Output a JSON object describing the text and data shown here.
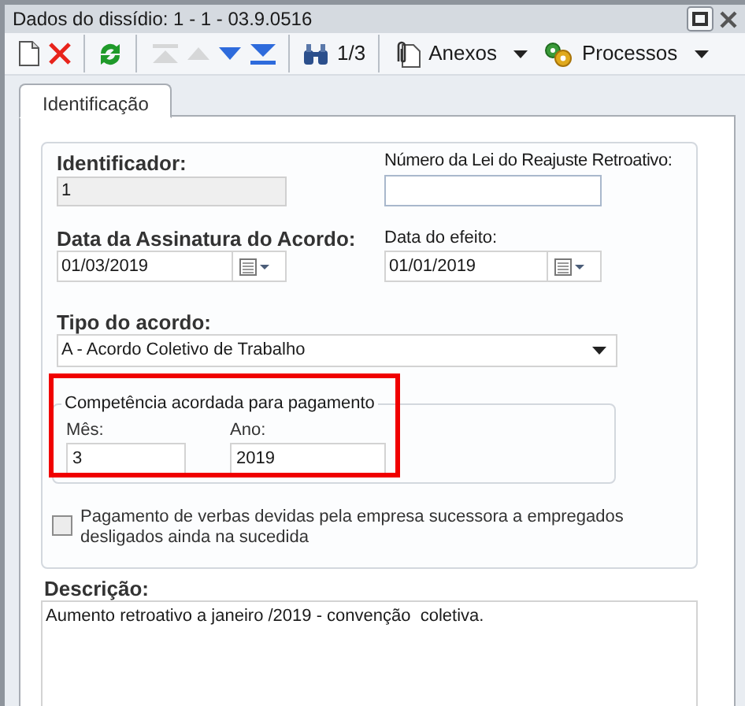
{
  "window": {
    "title": "Dados do dissídio: 1 - 1 - 03.9.0516"
  },
  "toolbar": {
    "items": [
      {
        "kind": "new",
        "disabled": false
      },
      {
        "kind": "delete",
        "disabled": false
      },
      {
        "kind": "refresh",
        "disabled": false
      },
      {
        "kind": "first",
        "disabled": true
      },
      {
        "kind": "previous",
        "disabled": true
      },
      {
        "kind": "next",
        "disabled": false
      },
      {
        "kind": "last",
        "disabled": false
      },
      {
        "kind": "find",
        "label": "1/3",
        "disabled": false
      },
      {
        "kind": "attachments",
        "label": "Anexos",
        "disabled": false
      },
      {
        "kind": "processes",
        "label": "Processos",
        "disabled": false
      }
    ]
  },
  "tabs": [
    {
      "label": "Identificação",
      "selected": true
    }
  ],
  "form": {
    "identificador": {
      "label": "Identificador:",
      "value": "1",
      "disabled": true
    },
    "numero_lei": {
      "label": "Número da Lei do Reajuste Retroativo:"
    },
    "data_assinatura": {
      "label": "Data da Assinatura do Acordo:",
      "value": "01/03/2019"
    },
    "data_efeito": {
      "label": "Data do efeito:",
      "value": "01/01/2019"
    },
    "tipo_acordo": {
      "label": "Tipo do acordo:",
      "value": "A - Acordo Coletivo de Trabalho"
    },
    "competencia": {
      "legend": "Competência acordada para pagamento",
      "highlighted": true,
      "mes": {
        "label": "Mês:",
        "value": "3"
      },
      "ano": {
        "label": "Ano:",
        "value": "2019"
      }
    },
    "pagamento_sucessora": {
      "label": "Pagamento de verbas devidas pela empresa sucessora a empregados desligados ainda na sucedida",
      "checked": false
    },
    "descricao": {
      "label": "Descrição:",
      "value": "Aumento retroativo a janeiro /2019 - convenção  coletiva."
    }
  }
}
